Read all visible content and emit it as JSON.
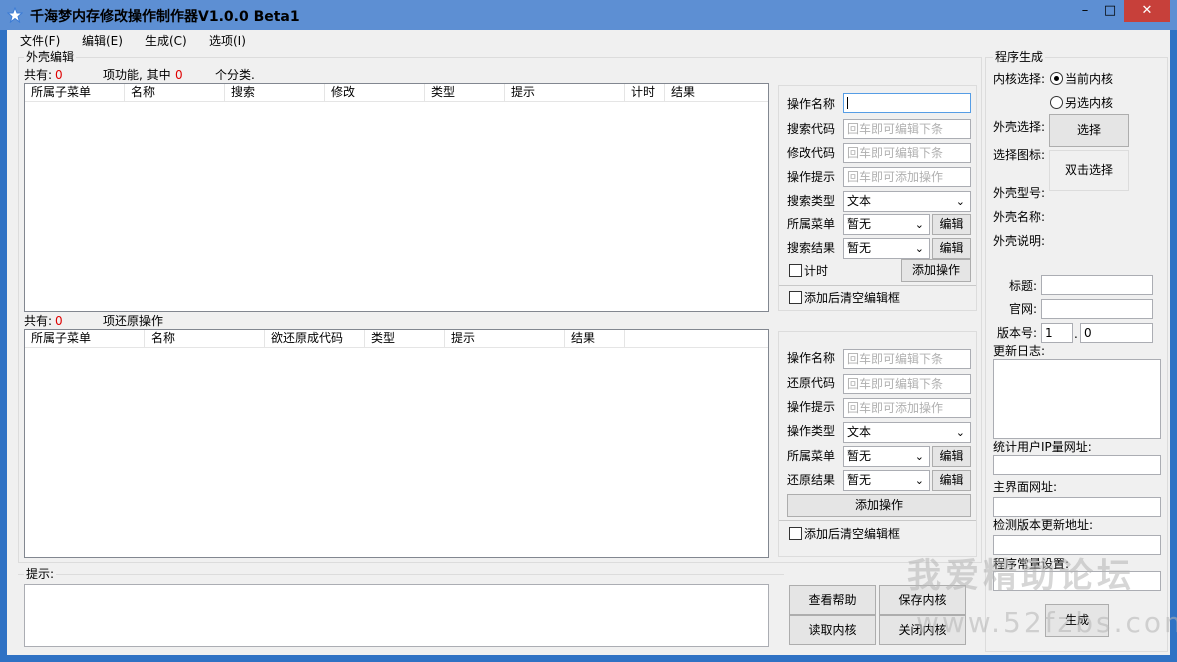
{
  "window": {
    "title": "千海梦内存修改操作制作器V1.0.0 Beta1",
    "min_glyph": "–",
    "max_glyph": "□",
    "close_glyph": "✕"
  },
  "menu": [
    "文件(F)",
    "编辑(E)",
    "生成(C)",
    "选项(I)"
  ],
  "shell_edit": {
    "group_label": "外壳编辑",
    "summary": {
      "prefix": "共有:",
      "count": "0",
      "mid": "项功能, 其中",
      "sub_count": "0",
      "suffix": "个分类."
    },
    "columns": [
      "所属子菜单",
      "名称",
      "搜索",
      "修改",
      "类型",
      "提示",
      "计时",
      "结果"
    ],
    "form": {
      "op_name_label": "操作名称",
      "op_name_value": "",
      "search_code_label": "搜索代码",
      "search_code_placeholder": "回车即可编辑下条",
      "modify_code_label": "修改代码",
      "modify_code_placeholder": "回车即可编辑下条",
      "op_hint_label": "操作提示",
      "op_hint_placeholder": "回车即可添加操作",
      "search_type_label": "搜索类型",
      "search_type_value": "文本",
      "menu_label": "所属菜单",
      "menu_value": "暂无",
      "menu_edit": "编辑",
      "result_label": "搜索结果",
      "result_value": "暂无",
      "result_edit": "编辑",
      "timer_label": "计时",
      "add_button": "添加操作",
      "clear_after_add": "添加后清空编辑框"
    }
  },
  "restore": {
    "summary": {
      "prefix": "共有:",
      "count": "0",
      "suffix": "项还原操作"
    },
    "columns": [
      "所属子菜单",
      "名称",
      "欲还原成代码",
      "类型",
      "提示",
      "结果"
    ],
    "form": {
      "op_name_label": "操作名称",
      "op_name_placeholder": "回车即可编辑下条",
      "restore_code_label": "还原代码",
      "restore_code_placeholder": "回车即可编辑下条",
      "op_hint_label": "操作提示",
      "op_hint_placeholder": "回车即可添加操作",
      "op_type_label": "操作类型",
      "op_type_value": "文本",
      "menu_label": "所属菜单",
      "menu_value": "暂无",
      "menu_edit": "编辑",
      "result_label": "还原结果",
      "result_value": "暂无",
      "result_edit": "编辑",
      "add_button": "添加操作",
      "clear_after_add": "添加后清空编辑框"
    }
  },
  "hint": {
    "label": "提示:",
    "text": ""
  },
  "bottom_buttons": {
    "help": "查看帮助",
    "save_core": "保存内核",
    "read_core": "读取内核",
    "close_core": "关闭内核"
  },
  "program": {
    "group_label": "程序生成",
    "core_select_label": "内核选择:",
    "core_current": "当前内核",
    "core_other": "另选内核",
    "shell_select_label": "外壳选择:",
    "shell_select_button": "选择",
    "icon_select_label": "选择图标:",
    "icon_select_button": "双击选择",
    "shell_model_label": "外壳型号:",
    "shell_name_label": "外壳名称:",
    "shell_desc_label": "外壳说明:",
    "title_label": "标题:",
    "title_value": "",
    "site_label": "官网:",
    "site_value": "",
    "version_label": "版本号:",
    "version_major": "1",
    "version_dot": ".",
    "version_minor": "0",
    "changelog_label": "更新日志:",
    "stats_url_label": "统计用户IP量网址:",
    "main_url_label": "主界面网址:",
    "update_url_label": "检测版本更新地址:",
    "const_label": "程序常量设置:",
    "generate_button": "生成"
  },
  "watermark": {
    "line1": "我爱精助论坛",
    "line2": "www.52fzbs.com"
  },
  "colors": {
    "titlebar": "#5d8fd3",
    "frame": "#2f72c4",
    "close": "#c7403a",
    "count_red": "#e00000"
  }
}
